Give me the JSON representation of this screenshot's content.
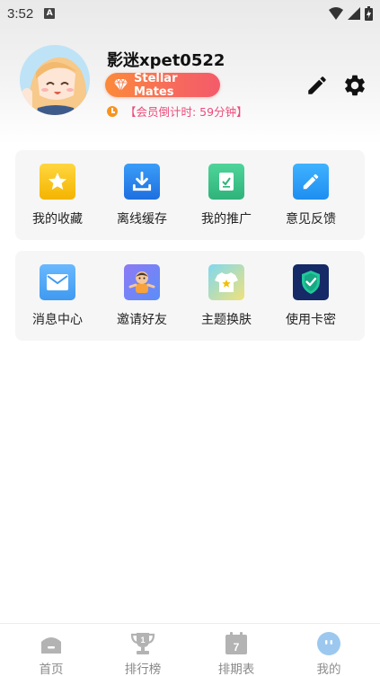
{
  "status_bar": {
    "time": "3:52",
    "indicator": "A"
  },
  "profile": {
    "username": "影迷xpet0522",
    "vip_label": "Stellar Mates",
    "countdown": "【会员倒计时: 59分钟】"
  },
  "menu_row1": [
    {
      "label": "我的收藏",
      "icon": "star-icon"
    },
    {
      "label": "离线缓存",
      "icon": "download-icon"
    },
    {
      "label": "我的推广",
      "icon": "promotion-icon"
    },
    {
      "label": "意见反馈",
      "icon": "feedback-pencil-icon"
    }
  ],
  "menu_row2": [
    {
      "label": "消息中心",
      "icon": "mail-icon"
    },
    {
      "label": "邀请好友",
      "icon": "invite-friend-icon"
    },
    {
      "label": "主题换肤",
      "icon": "theme-shirt-icon"
    },
    {
      "label": "使用卡密",
      "icon": "shield-check-icon"
    }
  ],
  "bottom_nav": [
    {
      "label": "首页",
      "icon": "home-icon"
    },
    {
      "label": "排行榜",
      "icon": "trophy-icon"
    },
    {
      "label": "排期表",
      "icon": "calendar-icon",
      "calendar_day": "7"
    },
    {
      "label": "我的",
      "icon": "profile-face-icon",
      "active": true
    }
  ],
  "colors": {
    "vip_gradient_start": "#fb8a3a",
    "vip_gradient_end": "#f45b6a",
    "countdown_text": "#ee4a7a",
    "active_nav": "#9cc8f0"
  }
}
